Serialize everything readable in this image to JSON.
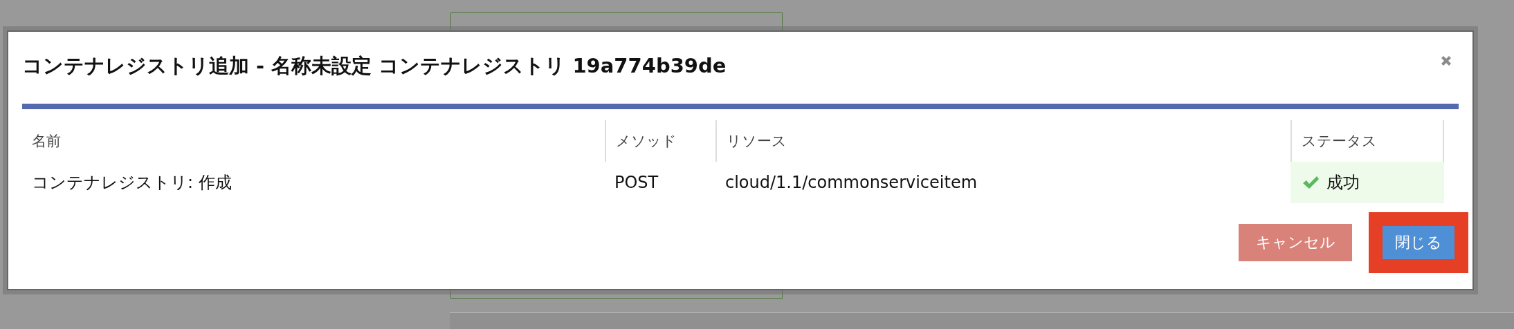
{
  "dialog": {
    "title": "コンテナレジストリ追加 - 名称未設定 コンテナレジストリ 19a774b39de",
    "progress": {
      "level": 1
    },
    "table": {
      "columns": [
        "名前",
        "メソッド",
        "リソース",
        "ステータス"
      ],
      "rows": [
        {
          "name": "コンテナレジストリ: 作成",
          "method": "POST",
          "resource": "cloud/1.1/commonserviceitem",
          "status": "成功",
          "kind": "success"
        }
      ]
    },
    "buttons": [
      {
        "label": "キャンセル",
        "kind": "cancel",
        "highlighted": false
      },
      {
        "label": "閉じる",
        "kind": "primary",
        "highlighted": true
      }
    ]
  }
}
